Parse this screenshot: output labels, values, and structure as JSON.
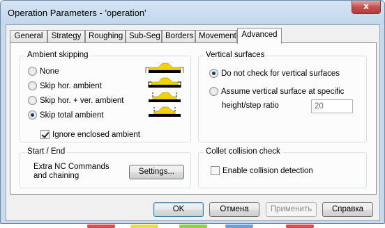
{
  "window": {
    "title": "Operation Parameters - 'operation'",
    "close_glyph": "x"
  },
  "tabs": [
    {
      "label": "General"
    },
    {
      "label": "Strategy"
    },
    {
      "label": "Roughing"
    },
    {
      "label": "Sub-Seg"
    },
    {
      "label": "Borders"
    },
    {
      "label": "Movement"
    },
    {
      "label": "Advanced",
      "active": true
    }
  ],
  "ambient": {
    "title": "Ambient skipping",
    "options": [
      "None",
      "Skip hor. ambient",
      "Skip hor. + ver. ambient",
      "Skip total ambient"
    ],
    "selected": "Skip total ambient",
    "ignore_enclosed_label": "Ignore enclosed ambient",
    "ignore_enclosed_checked": true
  },
  "vertical": {
    "title": "Vertical surfaces",
    "option_no_check": "Do not check for vertical surfaces",
    "option_assume": "Assume vertical surface at specific",
    "ratio_label": "height/step ratio",
    "ratio_value": "20",
    "selected": "Do not check for vertical surfaces"
  },
  "start_end": {
    "title": "Start / End",
    "line1": "Extra NC Commands",
    "line2": "and chaining",
    "settings_button": "Settings..."
  },
  "collet": {
    "title": "Collet collision check",
    "enable_label": "Enable collision detection",
    "enable_checked": false
  },
  "buttons": {
    "ok": "OK",
    "cancel": "Отмена",
    "apply": "Применить",
    "help": "Справка"
  },
  "colors": {
    "illustration_fill": "#f2d200",
    "illustration_base": "#000000",
    "tool_line": "#c04040"
  }
}
